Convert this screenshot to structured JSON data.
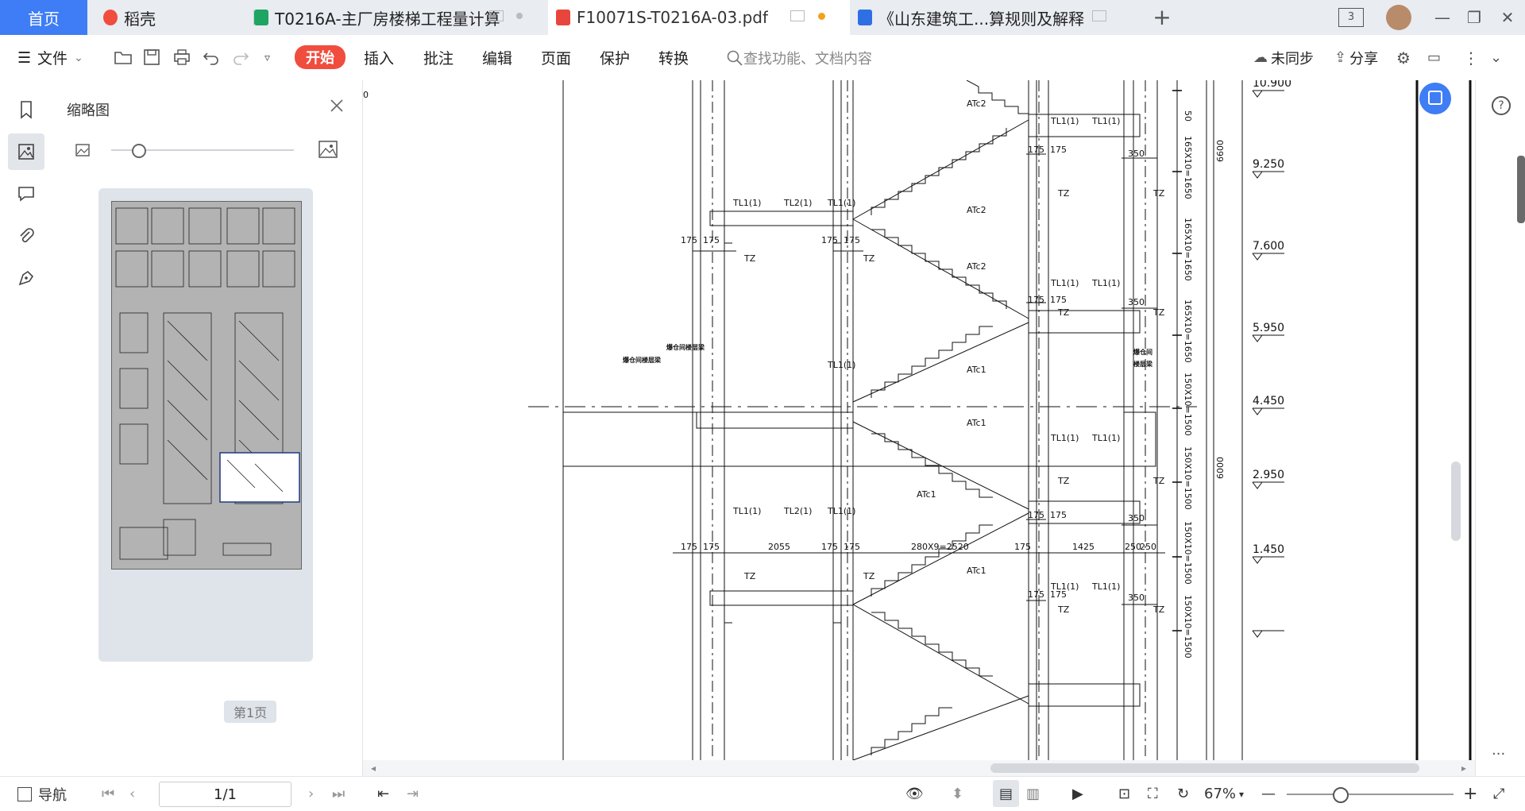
{
  "tabs": [
    {
      "label": "首页",
      "active": false
    },
    {
      "label": "稻壳",
      "active": false
    },
    {
      "label": "T0216A-主厂房楼梯工程量计算",
      "active": false
    },
    {
      "label": "F10071S-T0216A-03.pdf",
      "active": true
    },
    {
      "label": "《山东建筑工...算规则及解释",
      "active": false
    }
  ],
  "window": {
    "tab_count": "3"
  },
  "toolbar": {
    "file_label": "文件",
    "menus": [
      "开始",
      "插入",
      "批注",
      "编辑",
      "页面",
      "保护",
      "转换"
    ],
    "search_placeholder": "查找功能、文档内容",
    "sync_label": "未同步",
    "share_label": "分享"
  },
  "thumbnail_panel": {
    "title": "缩略图",
    "page_label": "第1页"
  },
  "drawing": {
    "elevations": [
      "10.900",
      "9.250",
      "7.600",
      "5.950",
      "4.450",
      "2.950",
      "1.450"
    ],
    "vertical_dims": [
      "165X10=1650",
      "165X10=1650",
      "165X10=1650",
      "150X10=1500",
      "150X10=1500",
      "150X10=1500",
      "150X10=1500"
    ],
    "total_dims": [
      "6600",
      "6000"
    ],
    "bottom_dims": [
      "175",
      "175",
      "2055",
      "175",
      "175",
      "280X9=2520",
      "175",
      "1425",
      "250",
      "250"
    ],
    "labels": {
      "atc2": "ATc2",
      "atc1": "ATc1",
      "tl11": "TL1(1)",
      "tl21": "TL2(1)",
      "tz": "TZ",
      "d175": "175",
      "d350": "350",
      "d50": "50",
      "note_left_a": "爆仓间楼层梁",
      "note_left_b": "爆仓间楼层梁",
      "note_right_a": "爆仓间",
      "note_right_b": "楼层梁",
      "left_edge": "0"
    }
  },
  "status": {
    "nav_label": "导航",
    "page_value": "1/1",
    "zoom": "67%"
  }
}
